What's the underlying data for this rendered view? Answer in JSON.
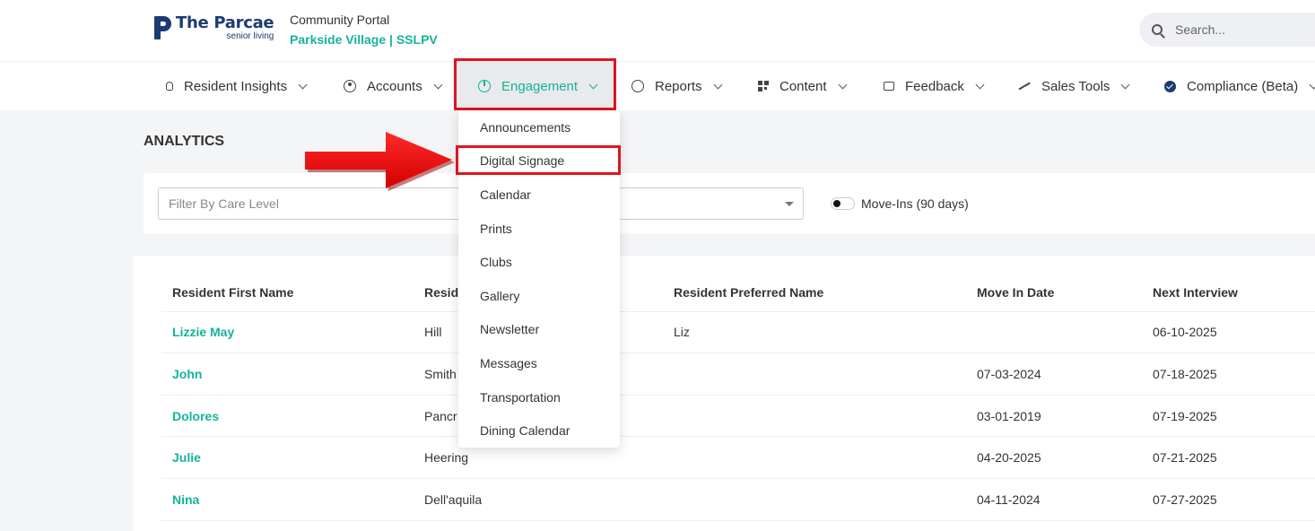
{
  "brand": {
    "name": "The Parcae",
    "tagline": "senior living",
    "color": "#1d3a72"
  },
  "portal": {
    "label": "Community Portal",
    "site": "Parkside Village | SSLPV"
  },
  "search": {
    "placeholder": "Search..."
  },
  "nav": {
    "items": [
      {
        "label": "Resident Insights",
        "icon": "lightbulb-icon"
      },
      {
        "label": "Accounts",
        "icon": "user-circle-icon"
      },
      {
        "label": "Engagement",
        "icon": "pie-chart-icon",
        "active": true
      },
      {
        "label": "Reports",
        "icon": "circle-icon"
      },
      {
        "label": "Content",
        "icon": "grid-icon"
      },
      {
        "label": "Feedback",
        "icon": "chat-icon"
      },
      {
        "label": "Sales Tools",
        "icon": "trend-icon"
      },
      {
        "label": "Compliance (Beta)",
        "icon": "badge-check-icon"
      }
    ]
  },
  "dropdown": {
    "items": [
      "Announcements",
      "Digital Signage",
      "Calendar",
      "Prints",
      "Clubs",
      "Gallery",
      "Newsletter",
      "Messages",
      "Transportation",
      "Dining Calendar"
    ],
    "highlighted": "Digital Signage"
  },
  "analytics": {
    "title": "ANALYTICS",
    "filter_placeholder": "Filter By Care Level",
    "toggle_label": "Move-Ins (90 days)"
  },
  "table": {
    "headers": [
      "Resident First Name",
      "Resid",
      "Resident Preferred Name",
      "Move In Date",
      "Next Interview"
    ],
    "rows": [
      [
        "Lizzie May",
        "Hill",
        "Liz",
        "",
        "06-10-2025"
      ],
      [
        "John",
        "Smith",
        "",
        "07-03-2024",
        "07-18-2025"
      ],
      [
        "Dolores",
        "Pancr",
        "",
        "03-01-2019",
        "07-19-2025"
      ],
      [
        "Julie",
        "Heering",
        "",
        "04-20-2025",
        "07-21-2025"
      ],
      [
        "Nina",
        "Dell'aquila",
        "",
        "04-11-2024",
        "07-27-2025"
      ]
    ]
  },
  "colors": {
    "accent": "#14b39a",
    "highlight": "#e0141e"
  }
}
